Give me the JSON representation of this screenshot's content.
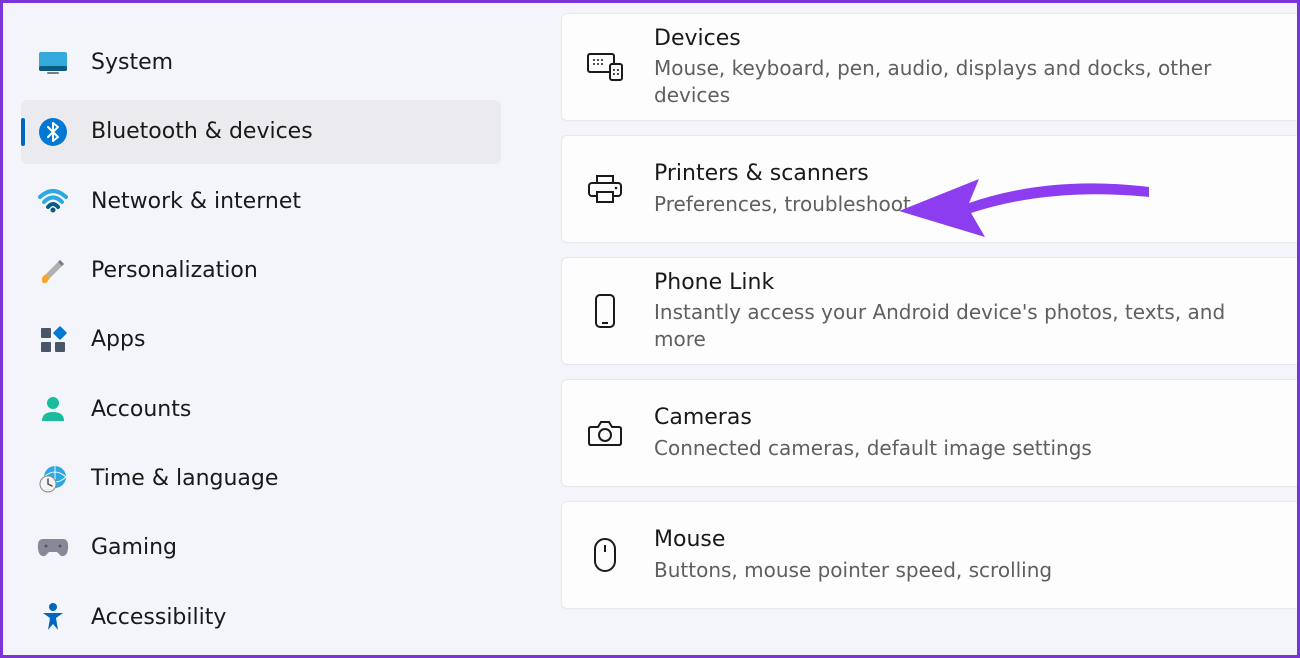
{
  "sidebar": {
    "items": [
      {
        "id": "system",
        "label": "System"
      },
      {
        "id": "bluetooth",
        "label": "Bluetooth & devices"
      },
      {
        "id": "network",
        "label": "Network & internet"
      },
      {
        "id": "personalization",
        "label": "Personalization"
      },
      {
        "id": "apps",
        "label": "Apps"
      },
      {
        "id": "accounts",
        "label": "Accounts"
      },
      {
        "id": "time",
        "label": "Time & language"
      },
      {
        "id": "gaming",
        "label": "Gaming"
      },
      {
        "id": "accessibility",
        "label": "Accessibility"
      }
    ],
    "active_index": 1
  },
  "main": {
    "cards": [
      {
        "id": "devices",
        "title": "Devices",
        "subtitle": "Mouse, keyboard, pen, audio, displays and docks, other devices"
      },
      {
        "id": "printers",
        "title": "Printers & scanners",
        "subtitle": "Preferences, troubleshoot"
      },
      {
        "id": "phone_link",
        "title": "Phone Link",
        "subtitle": "Instantly access your Android device's photos, texts, and more"
      },
      {
        "id": "cameras",
        "title": "Cameras",
        "subtitle": "Connected cameras, default image settings"
      },
      {
        "id": "mouse",
        "title": "Mouse",
        "subtitle": "Buttons, mouse pointer speed, scrolling"
      }
    ]
  },
  "annotation": {
    "arrow_color": "#8c3df0",
    "target_card_index": 1
  }
}
